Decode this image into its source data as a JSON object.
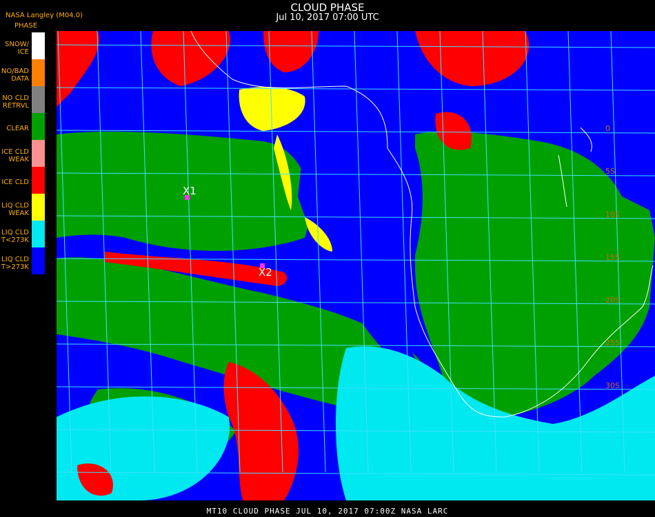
{
  "header": {
    "title": "CLOUD PHASE",
    "subtitle": "Jul 10, 2017 07:00 UTC",
    "producer": "NASA Langley (M04.0)"
  },
  "legend": {
    "header": "PHASE",
    "items": [
      {
        "label": "SNOW/\nICE",
        "color": "#ffffff"
      },
      {
        "label": "NO/BAD\nDATA",
        "color": "#ff8000"
      },
      {
        "label": "NO CLD\nRETRVL",
        "color": "#808080"
      },
      {
        "label": "CLEAR",
        "color": "#00a000"
      },
      {
        "label": "ICE CLD\nWEAK",
        "color": "#ff9090"
      },
      {
        "label": "ICE CLD",
        "color": "#ff0000"
      },
      {
        "label": "LIQ CLD\nWEAK",
        "color": "#ffff00"
      },
      {
        "label": "LIQ CLD\nT<273K",
        "color": "#00e8f0"
      },
      {
        "label": "LIQ CLD\nT>273K",
        "color": "#0000ff"
      }
    ]
  },
  "map": {
    "lat_labels": [
      "0",
      "5S",
      "10S",
      "15S",
      "20S",
      "25S",
      "30S"
    ],
    "markers": [
      {
        "label": "X1",
        "color": "#ff30ff"
      },
      {
        "label": "X2",
        "color": "#ff30ff"
      }
    ],
    "colors": {
      "clear": "#00a000",
      "liq_warm": "#0000ff",
      "liq_cold": "#00e8f0",
      "ice": "#ff0000",
      "liq_weak": "#ffff00",
      "grid": "#40e0ff",
      "coast": "#ffffff",
      "lat_label": "#c07010"
    }
  },
  "footer": {
    "text": "MT10  CLOUD PHASE   JUL 10, 2017 07:00Z   NASA LARC"
  }
}
